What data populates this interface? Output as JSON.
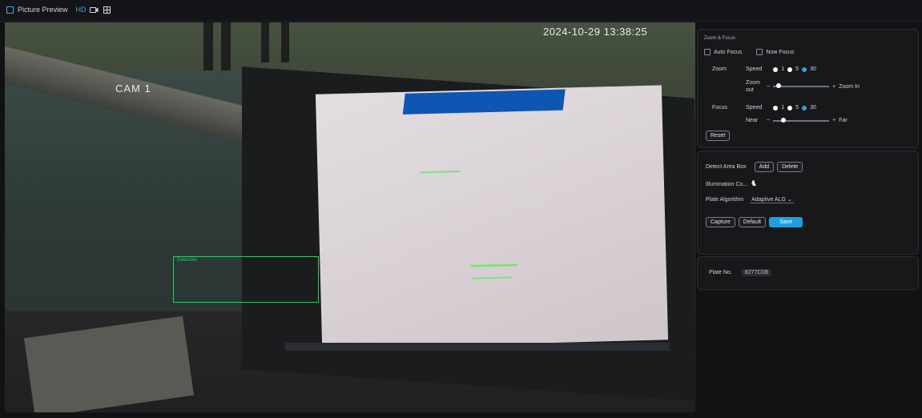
{
  "topbar": {
    "title": "Picture Preview",
    "hd_label": "HD",
    "icons": [
      "camera-icon",
      "grid-icon"
    ]
  },
  "video": {
    "cam_label": "CAM 1",
    "timestamp": "2024-10-29 13:38:25",
    "detect_label": "Detection"
  },
  "zoom_focus": {
    "title": "Zoom & Focus",
    "auto_focus": "Auto Focus",
    "one_focus": "Now Focus",
    "zoom_label": "Zoom",
    "speed_label": "Speed",
    "speed_opts": [
      "1",
      "5",
      "30"
    ],
    "zoom_out": "Zoom out",
    "zoom_in": "Zoom In",
    "focus_label": "Focus",
    "near_label": "Near",
    "far_label": "Far",
    "reset": "Reset"
  },
  "detect": {
    "area_label": "Detect Area Box",
    "add": "Add",
    "delete": "Delete",
    "illum_label": "Illumination Co...",
    "algo_label": "Plate Algorithm",
    "algo_value": "Adaptive ALG",
    "actions": [
      "Capture",
      "Default",
      "Save"
    ]
  },
  "plate": {
    "label": "Plate No.",
    "value": "8277C0B"
  }
}
